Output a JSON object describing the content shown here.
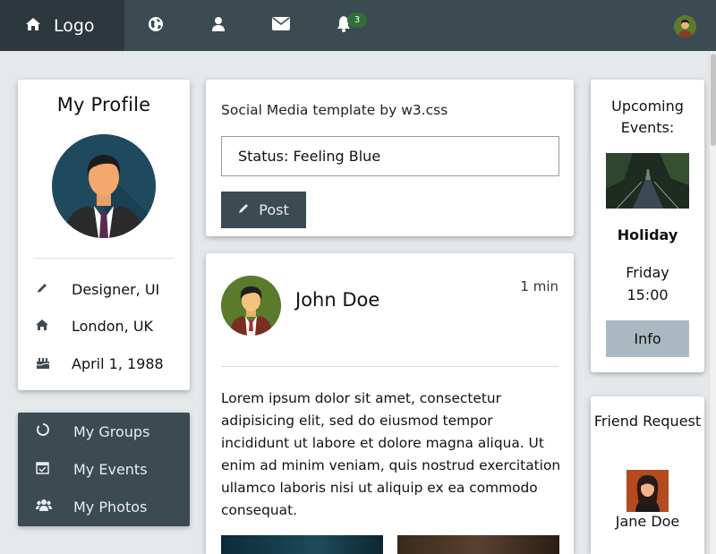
{
  "topbar": {
    "logo_label": "Logo",
    "icons": [
      "home-icon",
      "globe-icon",
      "user-icon",
      "envelope-icon",
      "bell-icon"
    ],
    "notifications_count": "3"
  },
  "profile": {
    "title": "My Profile",
    "job": "Designer, UI",
    "location": "London, UK",
    "birthday": "April 1, 1988"
  },
  "menu": {
    "items": [
      {
        "label": "My Groups",
        "icon": "circle-notch-icon"
      },
      {
        "label": "My Events",
        "icon": "calendar-check-icon"
      },
      {
        "label": "My Photos",
        "icon": "users-icon"
      }
    ]
  },
  "composer": {
    "title": "Social Media template by w3.css",
    "status_value": "Status: Feeling Blue",
    "post_label": "Post"
  },
  "post": {
    "author": "John Doe",
    "time": "1 min",
    "text": "Lorem ipsum dolor sit amet, consectetur adipisicing elit, sed do eiusmod tempor incididunt ut labore et dolore magna aliqua. Ut enim ad minim veniam, quis nostrud exercitation ullamco laboris nisi ut aliquip ex ea commodo consequat."
  },
  "events": {
    "title": "Upcoming Events:",
    "event_name": "Holiday",
    "event_day": "Friday",
    "event_time": "15:00",
    "info_label": "Info"
  },
  "friend_request": {
    "title": "Friend Request",
    "name": "Jane Doe"
  },
  "colors": {
    "theme_dark": "#3c4a52",
    "theme_darker": "#2d383e",
    "badge_green": "#2f6e35",
    "info_button": "#aab9c1"
  }
}
